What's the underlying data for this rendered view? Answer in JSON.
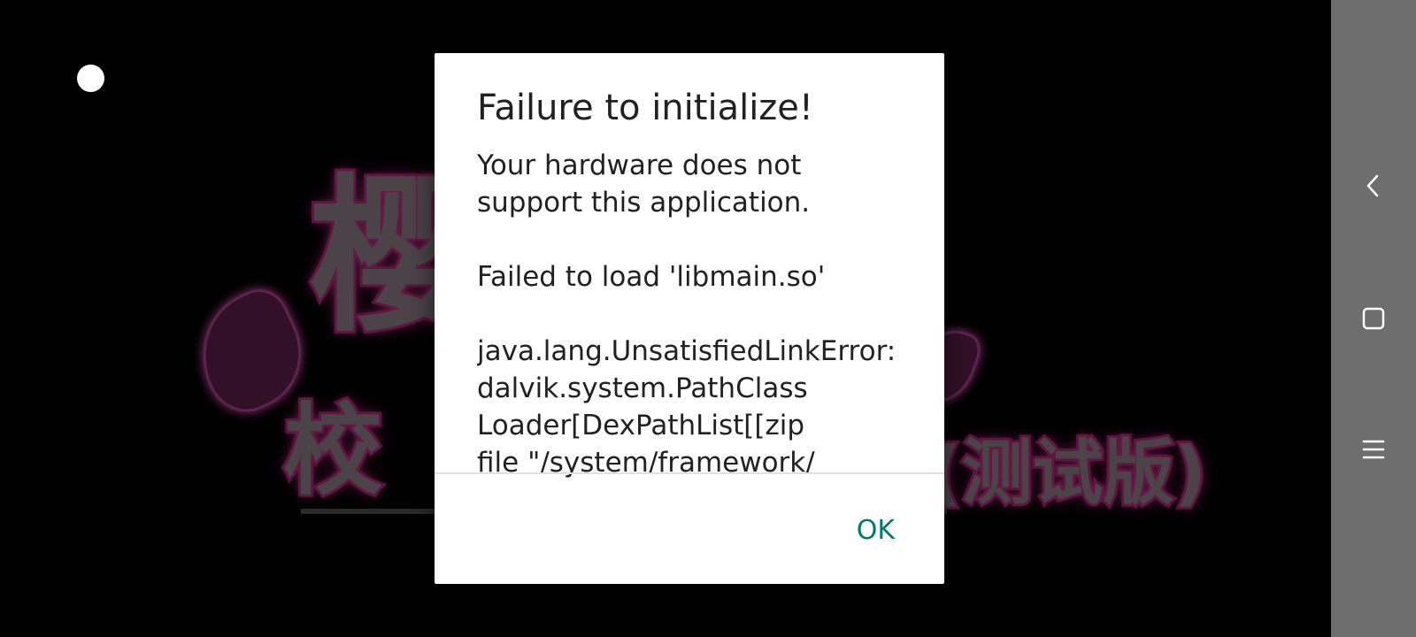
{
  "splash": {
    "title_main": "樱",
    "title_sub": "校",
    "tag": "(测试版)"
  },
  "dialog": {
    "title": "Failure to initialize!",
    "messages": [
      "Your hardware does not\nsupport this application.",
      "Failed to load 'libmain.so'",
      "java.lang.UnsatisfiedLinkError:\ndalvik.system.PathClass\nLoader[DexPathList[[zip\nfile \"/system/framework/"
    ],
    "ok_label": "OK"
  },
  "nav_bar": {
    "back_icon": "back-chevron-icon",
    "home_icon": "square-home-icon",
    "menu_icon": "hamburger-menu-icon"
  },
  "colors": {
    "dialog_accent": "#00796b",
    "nav_bar_bg": "#6e6e6e",
    "splash_glow": "#b0217a"
  }
}
